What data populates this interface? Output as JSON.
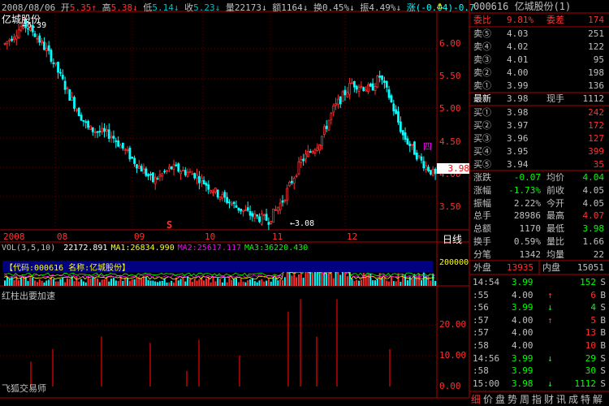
{
  "stock": {
    "name": "亿城股份",
    "code": "000616",
    "title": "000616  亿城股份(1)"
  },
  "info_bar": {
    "date": "2008/08/06",
    "open_label": "开",
    "open": "5.35",
    "high_label": "高",
    "high": "5.38",
    "low_label": "低",
    "low": "5.14",
    "close_label": "收",
    "close": "5.23",
    "vol_label": "量",
    "vol": "22173",
    "amt_label": "额",
    "amt": "1164",
    "turnover_label": "换",
    "turnover": "0.45%",
    "amp_label": "振",
    "amp": "4.49%",
    "chg_label": "涨",
    "chg": "(-0.04)-0.7"
  },
  "chart_data": [
    {
      "type": "candlestick",
      "title": "亿城股份",
      "x_labels": [
        "2008",
        "08",
        "09",
        "10",
        "11",
        "12"
      ],
      "y_ticks": [
        "6.00",
        "5.50",
        "5.00",
        "4.50",
        "4.00",
        "3.50"
      ],
      "ylim": [
        3.15,
        6.5
      ],
      "annotations": [
        "6.39",
        "3.08",
        "S",
        "四"
      ],
      "price_tag": "3.98",
      "trend_points": [
        [
          0,
          6.0
        ],
        [
          8,
          6.3
        ],
        [
          12,
          6.2
        ],
        [
          20,
          5.8
        ],
        [
          28,
          5.2
        ],
        [
          36,
          4.7
        ],
        [
          46,
          4.6
        ],
        [
          56,
          4.2
        ],
        [
          64,
          3.9
        ],
        [
          72,
          4.1
        ],
        [
          82,
          4.0
        ],
        [
          92,
          3.7
        ],
        [
          100,
          3.5
        ],
        [
          108,
          3.35
        ],
        [
          114,
          3.3
        ],
        [
          120,
          3.6
        ],
        [
          128,
          4.2
        ],
        [
          136,
          4.5
        ],
        [
          142,
          5.0
        ],
        [
          150,
          5.4
        ],
        [
          158,
          5.3
        ],
        [
          162,
          5.5
        ],
        [
          166,
          5.2
        ],
        [
          172,
          4.6
        ],
        [
          180,
          4.2
        ],
        [
          186,
          3.98
        ]
      ]
    },
    {
      "type": "bar",
      "title": "VOL(3,5,10)",
      "legend": [
        {
          "label": "22172.891",
          "color": "#ffffff"
        },
        {
          "label": "MA1:26834.990",
          "color": "#ffff00"
        },
        {
          "label": "MA2:25617.117",
          "color": "#ff00ff"
        },
        {
          "label": "MA3:36220.430",
          "color": "#00ff00"
        }
      ],
      "y_ticks": [
        "200000"
      ],
      "overlay_text": "【代码:000616 名称:亿城股份】"
    },
    {
      "type": "bar",
      "title": "红柱出要加速",
      "y_ticks": [
        "20.00",
        "10.00",
        "0.00"
      ],
      "ylim": [
        0,
        30
      ]
    }
  ],
  "bottom_left": "飞狐交易师",
  "right_tab": "日线",
  "quote": {
    "ratio_label": "委比",
    "ratio": "9.81%",
    "diff_label": "委差",
    "diff": "174",
    "sells": [
      {
        "label": "卖⑤",
        "price": "4.03",
        "vol": "251"
      },
      {
        "label": "卖④",
        "price": "4.02",
        "vol": "122"
      },
      {
        "label": "卖③",
        "price": "4.01",
        "vol": "95"
      },
      {
        "label": "卖②",
        "price": "4.00",
        "vol": "198"
      },
      {
        "label": "卖①",
        "price": "3.99",
        "vol": "136"
      }
    ],
    "last_label": "最新",
    "last": "3.98",
    "cur_vol_label": "现手",
    "cur_vol": "1112",
    "buys": [
      {
        "label": "买①",
        "price": "3.98",
        "vol": "242"
      },
      {
        "label": "买②",
        "price": "3.97",
        "vol": "172"
      },
      {
        "label": "买③",
        "price": "3.96",
        "vol": "127"
      },
      {
        "label": "买④",
        "price": "3.95",
        "vol": "399"
      },
      {
        "label": "买⑤",
        "price": "3.94",
        "vol": "35"
      }
    ],
    "stats": [
      {
        "l1": "涨跌",
        "v1": "-0.07",
        "l2": "均价",
        "v2": "4.04",
        "c1": "#00ff00",
        "c2": "#00ff00"
      },
      {
        "l1": "涨幅",
        "v1": "-1.73%",
        "l2": "前收",
        "v2": "4.05",
        "c1": "#00ff00",
        "c2": "#c0c0c0"
      },
      {
        "l1": "振幅",
        "v1": "2.22%",
        "l2": "今开",
        "v2": "4.05",
        "c1": "#c0c0c0",
        "c2": "#c0c0c0"
      },
      {
        "l1": "总手",
        "v1": "28986",
        "l2": "最高",
        "v2": "4.07",
        "c1": "#c0c0c0",
        "c2": "#ff3030"
      },
      {
        "l1": "总额",
        "v1": "1170",
        "l2": "最低",
        "v2": "3.98",
        "c1": "#c0c0c0",
        "c2": "#00ff00"
      },
      {
        "l1": "换手",
        "v1": "0.59%",
        "l2": "量比",
        "v2": "1.66",
        "c1": "#c0c0c0",
        "c2": "#c0c0c0"
      },
      {
        "l1": "分笔",
        "v1": "1342",
        "l2": "均量",
        "v2": "22",
        "c1": "#c0c0c0",
        "c2": "#c0c0c0"
      }
    ],
    "outer_label": "外盘",
    "outer": "13935",
    "inner_label": "内盘",
    "inner": "15051"
  },
  "ticks": [
    {
      "time": "14:54",
      "price": "3.99",
      "arrow": "",
      "vol": "152",
      "bs": "S",
      "pc": "#00ff00",
      "vc": "#00ff00"
    },
    {
      "time": ":55",
      "price": "4.00",
      "arrow": "↑",
      "vol": "6",
      "bs": "B",
      "pc": "#c0c0c0",
      "vc": "#ff3030"
    },
    {
      "time": ":56",
      "price": "3.99",
      "arrow": "↓",
      "vol": "4",
      "bs": "S",
      "pc": "#00ff00",
      "vc": "#00ff00"
    },
    {
      "time": ":57",
      "price": "4.00",
      "arrow": "↑",
      "vol": "5",
      "bs": "B",
      "pc": "#c0c0c0",
      "vc": "#ff3030"
    },
    {
      "time": ":57",
      "price": "4.00",
      "arrow": "",
      "vol": "13",
      "bs": "B",
      "pc": "#c0c0c0",
      "vc": "#ff3030"
    },
    {
      "time": ":58",
      "price": "4.00",
      "arrow": "",
      "vol": "10",
      "bs": "B",
      "pc": "#c0c0c0",
      "vc": "#ff3030"
    },
    {
      "time": "14:56",
      "price": "3.99",
      "arrow": "↓",
      "vol": "29",
      "bs": "S",
      "pc": "#00ff00",
      "vc": "#00ff00"
    },
    {
      "time": ":58",
      "price": "3.99",
      "arrow": "",
      "vol": "30",
      "bs": "S",
      "pc": "#00ff00",
      "vc": "#00ff00"
    },
    {
      "time": "15:00",
      "price": "3.98",
      "arrow": "↓",
      "vol": "1112",
      "bs": "S",
      "pc": "#00ff00",
      "vc": "#00ff00"
    }
  ],
  "bottom_tabs": [
    "细",
    "价",
    "盘",
    "势",
    "周",
    "指",
    "财",
    "讯",
    "成",
    "特",
    "解"
  ]
}
